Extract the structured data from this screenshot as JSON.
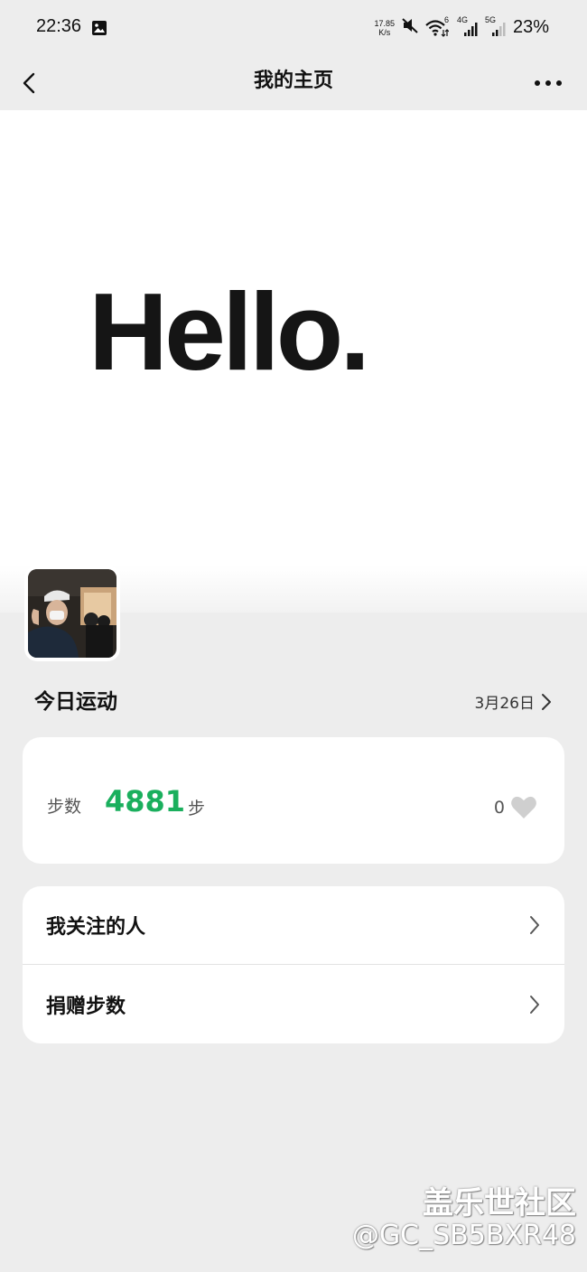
{
  "status_bar": {
    "time": "22:36",
    "net_speed_value": "17.85",
    "net_speed_unit": "K/s",
    "wifi_badge": "6",
    "signal1_label": "4G",
    "signal2_label": "5G",
    "battery": "23%"
  },
  "navbar": {
    "title": "我的主页"
  },
  "cover": {
    "text": "Hello."
  },
  "today": {
    "title": "今日运动",
    "date": "3月26日"
  },
  "steps": {
    "label": "步数",
    "value": "4881",
    "unit": "步",
    "likes": "0"
  },
  "menu": {
    "items": [
      {
        "label": "我关注的人"
      },
      {
        "label": "捐赠步数"
      }
    ]
  },
  "watermark": {
    "community": "盖乐世社区",
    "user": "@GC_SB5BXR48"
  },
  "colors": {
    "accent_green": "#1aaf5d",
    "background": "#ededed",
    "card": "#ffffff"
  }
}
